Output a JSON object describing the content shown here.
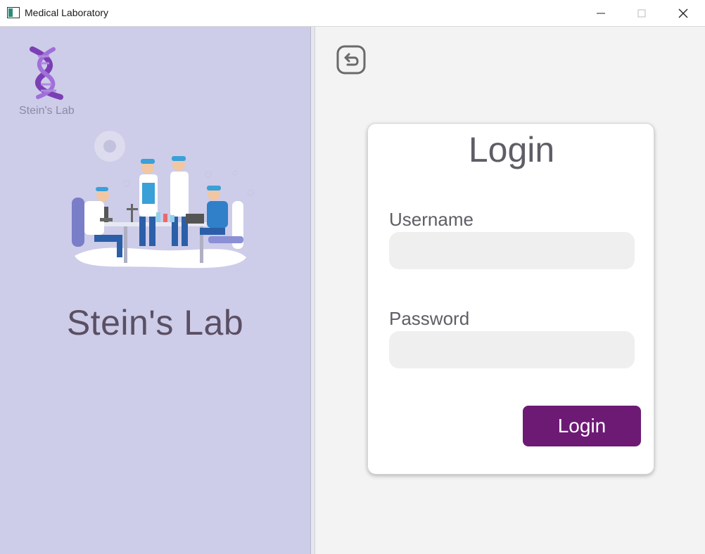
{
  "window": {
    "title": "Medical Laboratory"
  },
  "left_panel": {
    "logo_text": "Stein's Lab",
    "brand_title": "Stein's Lab",
    "background": "#cdcce9"
  },
  "login": {
    "title": "Login",
    "username_label": "Username",
    "username_value": "",
    "password_label": "Password",
    "password_value": "",
    "submit_label": "Login"
  },
  "colors": {
    "accent": "#6d1a75",
    "panel": "#cdcce9",
    "text": "#5e5e66"
  },
  "icons": {
    "back": "back-arrow-icon",
    "logo": "dna-icon",
    "minimize": "minimize-icon",
    "maximize": "maximize-icon",
    "close": "close-icon"
  }
}
